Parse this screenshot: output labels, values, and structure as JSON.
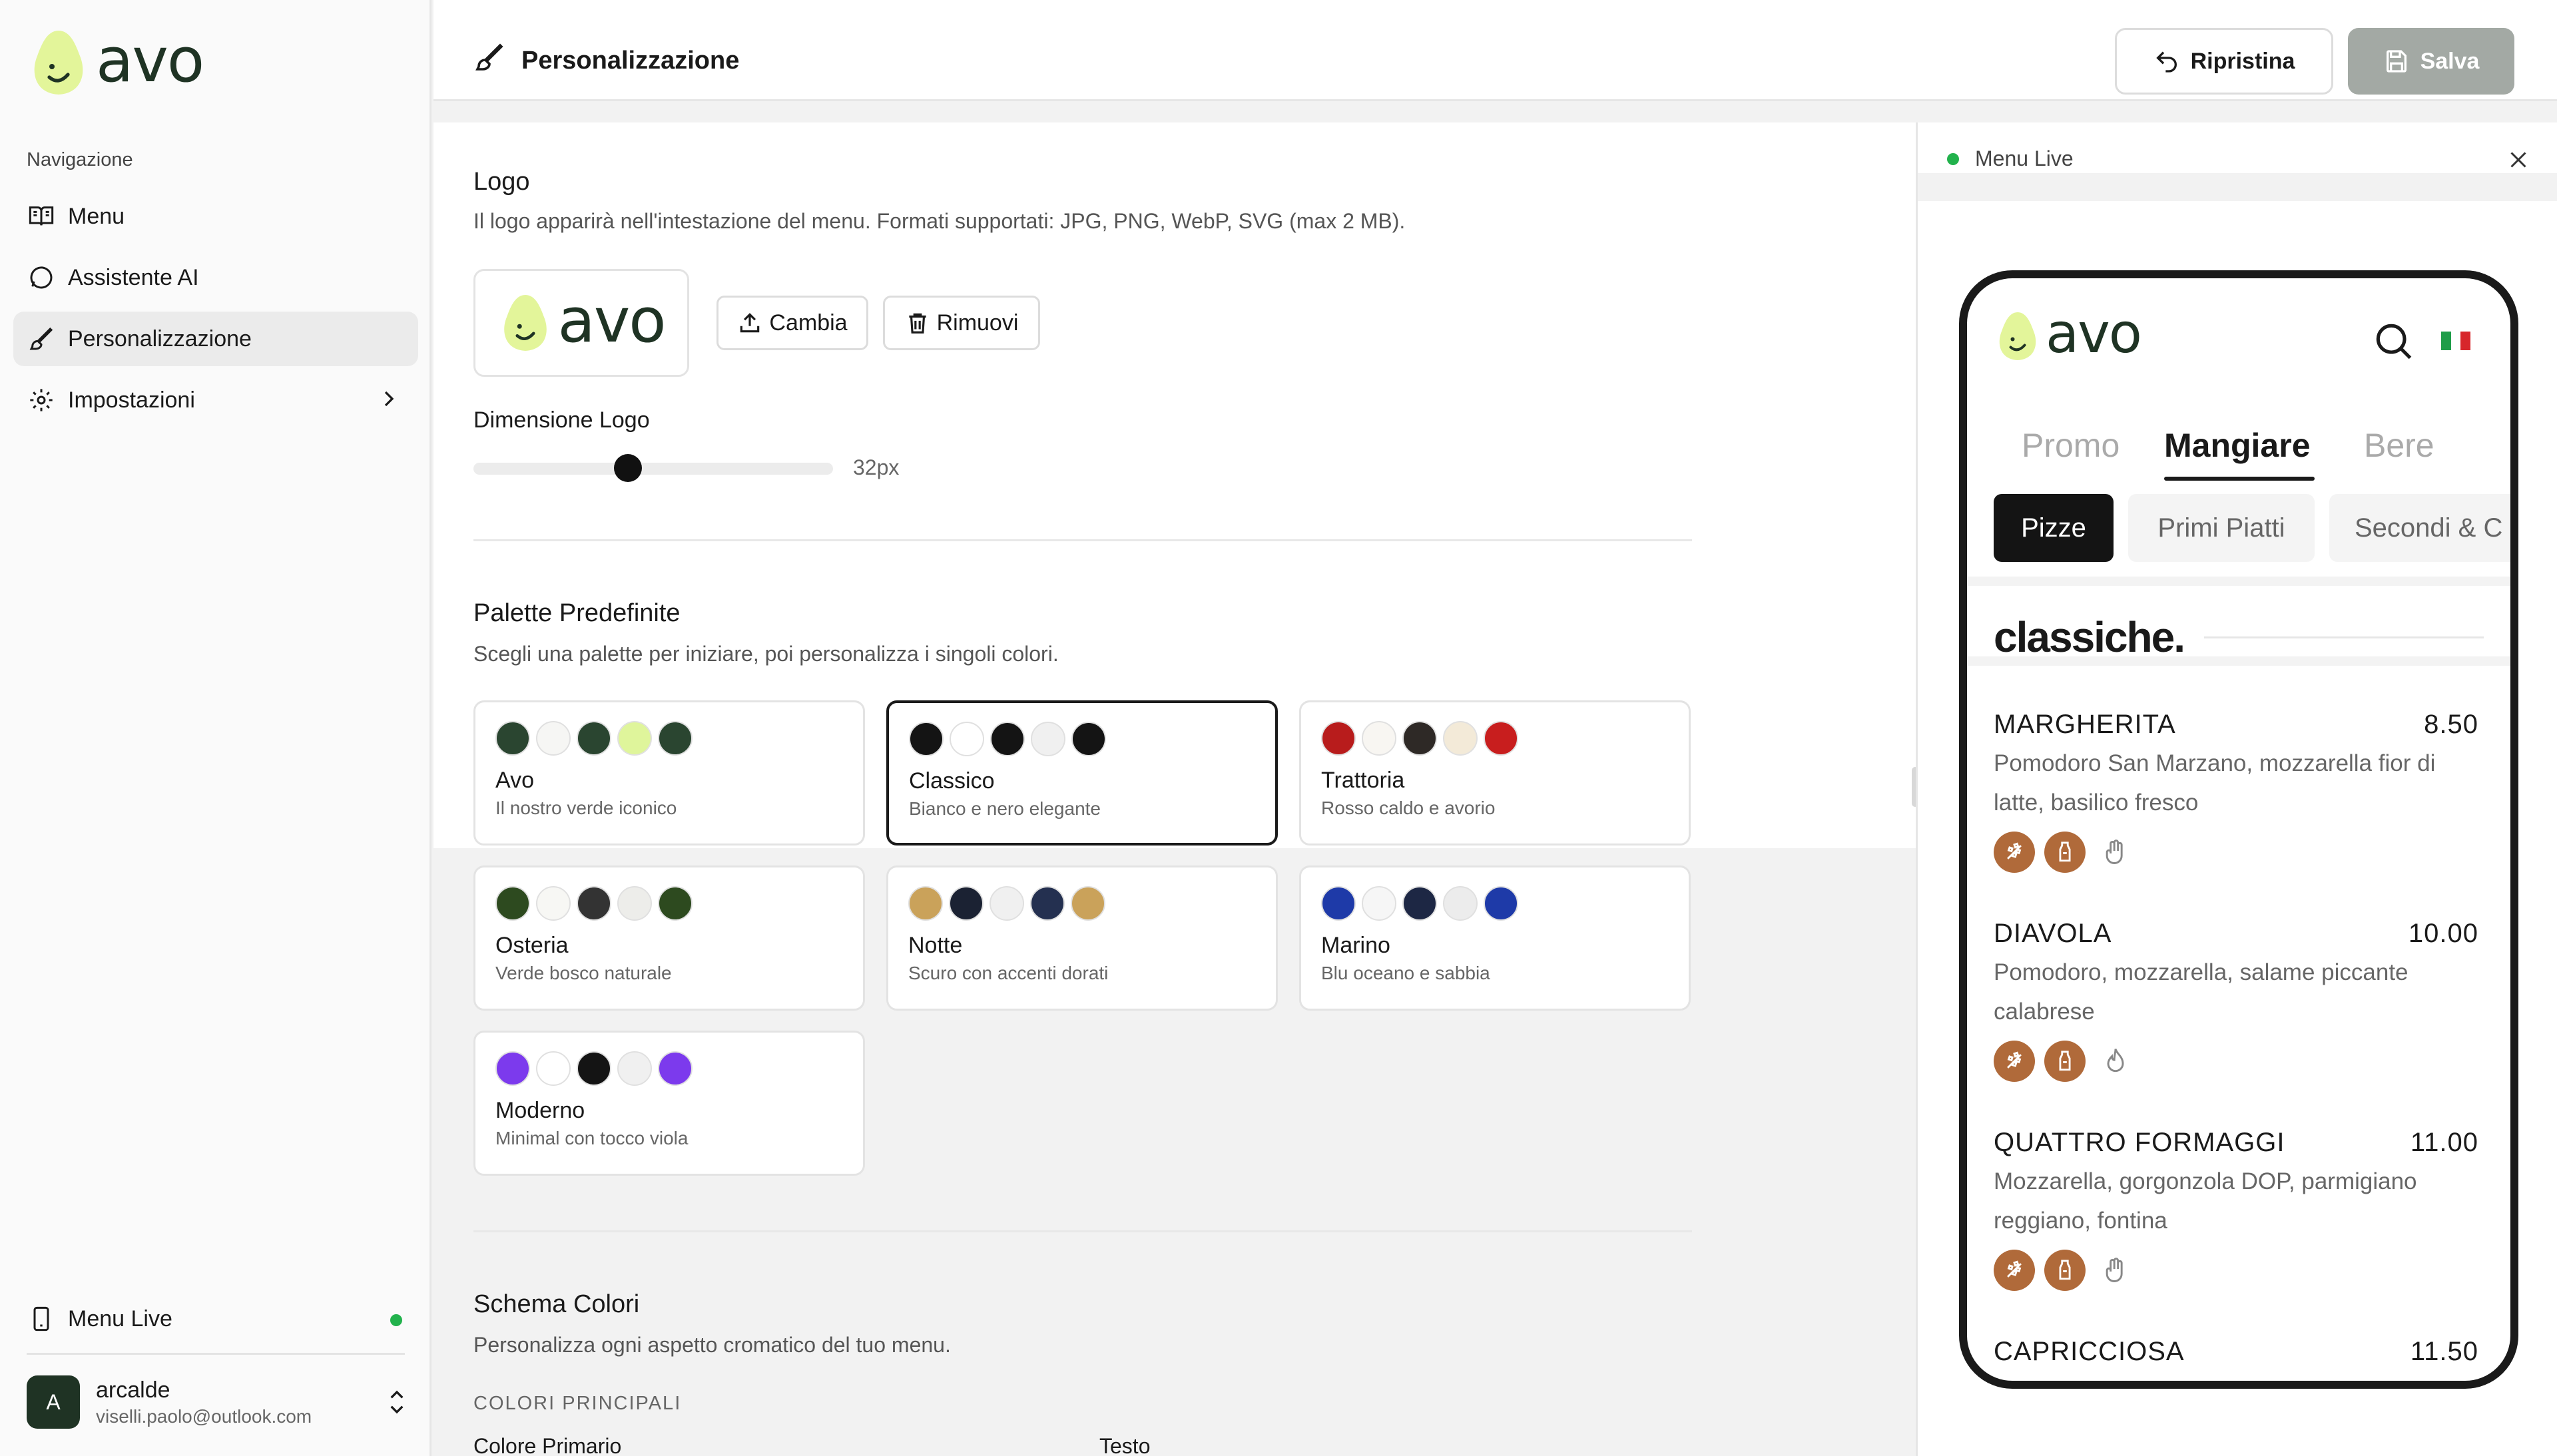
{
  "brand": {
    "name": "avo",
    "color": "#1f3324",
    "accent": "#e3f59a"
  },
  "sidebar": {
    "heading": "Navigazione",
    "items": [
      {
        "label": "Menu",
        "icon": "book-open-icon"
      },
      {
        "label": "Assistente AI",
        "icon": "message-circle-icon"
      },
      {
        "label": "Personalizzazione",
        "icon": "brush-icon",
        "active": true
      },
      {
        "label": "Impostazioni",
        "icon": "gear-icon"
      }
    ],
    "live_label": "Menu Live",
    "user": {
      "initial": "A",
      "name": "arcalde",
      "email": "viselli.paolo@outlook.com"
    }
  },
  "header": {
    "title": "Personalizzazione",
    "reset_label": "Ripristina",
    "save_label": "Salva"
  },
  "logo_section": {
    "title": "Logo",
    "description": "Il logo apparirà nell'intestazione del menu. Formati supportati: JPG, PNG, WebP, SVG (max 2 MB).",
    "change_label": "Cambia",
    "remove_label": "Rimuovi",
    "size_label": "Dimensione Logo",
    "size_value": "32px",
    "size_fraction": 0.43
  },
  "palette_section": {
    "title": "Palette Predefinite",
    "description": "Scegli una palette per iniziare, poi personalizza i singoli colori.",
    "palettes": [
      {
        "name": "Avo",
        "desc": "Il nostro verde iconico",
        "colors": [
          "#2a4530",
          "#f6f6f4",
          "#2a4530",
          "#dff59b",
          "#2a4530"
        ]
      },
      {
        "name": "Classico",
        "desc": "Bianco e nero elegante",
        "colors": [
          "#141414",
          "#ffffff",
          "#141414",
          "#f0f0f0",
          "#141414"
        ],
        "selected": true
      },
      {
        "name": "Trattoria",
        "desc": "Rosso caldo e avorio",
        "colors": [
          "#b81c1c",
          "#f8f6f2",
          "#2e2926",
          "#f3ead8",
          "#c81e1e"
        ]
      },
      {
        "name": "Osteria",
        "desc": "Verde bosco naturale",
        "colors": [
          "#2d4a1f",
          "#f7f7f4",
          "#333333",
          "#ededea",
          "#2d4a1f"
        ]
      },
      {
        "name": "Notte",
        "desc": "Scuro con accenti dorati",
        "colors": [
          "#caa25a",
          "#1b2233",
          "#f0f0f0",
          "#243050",
          "#caa25a"
        ]
      },
      {
        "name": "Marino",
        "desc": "Blu oceano e sabbia",
        "colors": [
          "#1e3aa8",
          "#f6f6f6",
          "#1d2744",
          "#ececec",
          "#1e3aa8"
        ]
      },
      {
        "name": "Moderno",
        "desc": "Minimal con tocco viola",
        "colors": [
          "#7c3aed",
          "#ffffff",
          "#141414",
          "#f0f0f0",
          "#7c3aed"
        ]
      }
    ]
  },
  "color_scheme": {
    "title": "Schema Colori",
    "description": "Personalizza ogni aspetto cromatico del tuo menu.",
    "group_label": "COLORI PRINCIPALI",
    "field_primary": "Colore Primario",
    "field_text": "Testo"
  },
  "preview": {
    "title": "Menu Live",
    "tabs": [
      "Promo",
      "Mangiare",
      "Bere"
    ],
    "active_tab": "Mangiare",
    "chips": [
      "Pizze",
      "Primi Piatti",
      "Secondi & C"
    ],
    "category": "classiche.",
    "dishes": [
      {
        "name": "MARGHERITA",
        "price": "8.50",
        "desc": "Pomodoro San Marzano, mozzarella fior di latte, basilico fresco",
        "allergens": [
          "wheat-icon",
          "milk-icon",
          "vegetarian-hand-icon"
        ]
      },
      {
        "name": "DIAVOLA",
        "price": "10.00",
        "desc": "Pomodoro, mozzarella, salame piccante calabrese",
        "allergens": [
          "wheat-icon",
          "milk-icon",
          "spicy-flame-icon"
        ]
      },
      {
        "name": "QUATTRO FORMAGGI",
        "price": "11.00",
        "desc": "Mozzarella, gorgonzola DOP, parmigiano reggiano, fontina",
        "allergens": [
          "wheat-icon",
          "milk-icon",
          "vegetarian-hand-icon"
        ]
      },
      {
        "name": "CAPRICCIOSA",
        "price": "11.50",
        "desc": "",
        "allergens": []
      }
    ],
    "allergen_color": "#b06a3a",
    "live_color": "#22b24c"
  }
}
